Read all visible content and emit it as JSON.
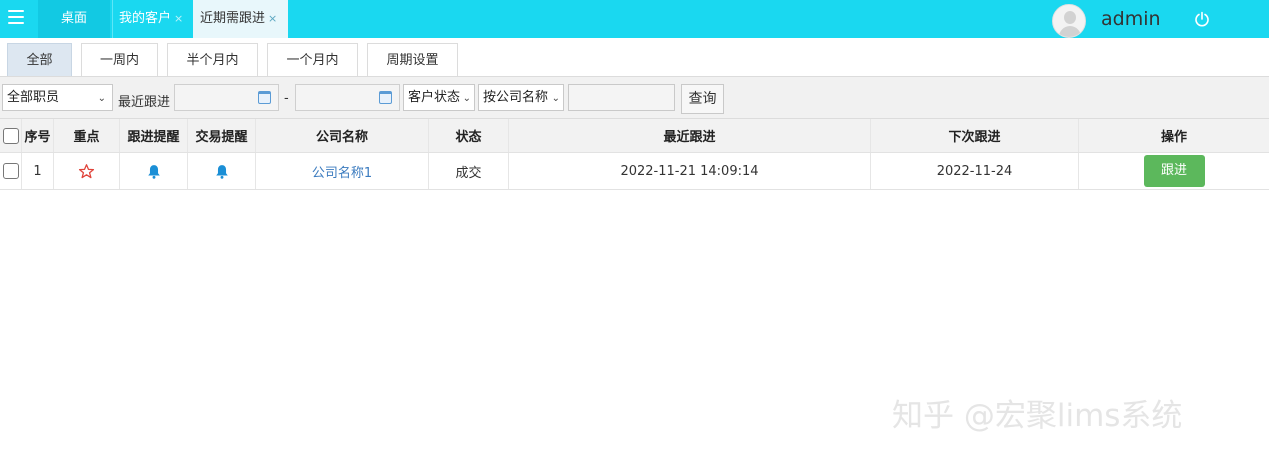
{
  "header": {
    "tabs": [
      {
        "label": "桌面"
      },
      {
        "label": "我的客户",
        "close": "×"
      },
      {
        "label": "近期需跟进",
        "close": "×"
      }
    ],
    "username": "admin",
    "colors": {
      "topbar": "#1ad8f0"
    },
    "icons": {
      "menu": "menu-icon",
      "avatar": "avatar-icon",
      "power": "power-icon"
    }
  },
  "period_tabs": [
    "全部",
    "一周内",
    "半个月内",
    "一个月内",
    "周期设置"
  ],
  "filters": {
    "employee_select": "全部职员",
    "recent_label": "最近跟进",
    "date_sep": "-",
    "status_select": "客户状态",
    "company_select": "按公司名称",
    "query_button": "查询"
  },
  "table": {
    "headers": [
      "序号",
      "重点",
      "跟进提醒",
      "交易提醒",
      "公司名称",
      "状态",
      "最近跟进",
      "下次跟进",
      "操作"
    ],
    "rows": [
      {
        "index": "1",
        "company": "公司名称1",
        "status": "成交",
        "last_follow": "2022-11-21 14:09:14",
        "next_follow": "2022-11-24",
        "action": "跟进"
      }
    ],
    "colors": {
      "link": "#3b7bbf",
      "star": "#e0433a",
      "bell": "#1b8fd6",
      "action_button": "#5cb85c"
    }
  },
  "watermark": "知乎 @宏聚lims系统"
}
